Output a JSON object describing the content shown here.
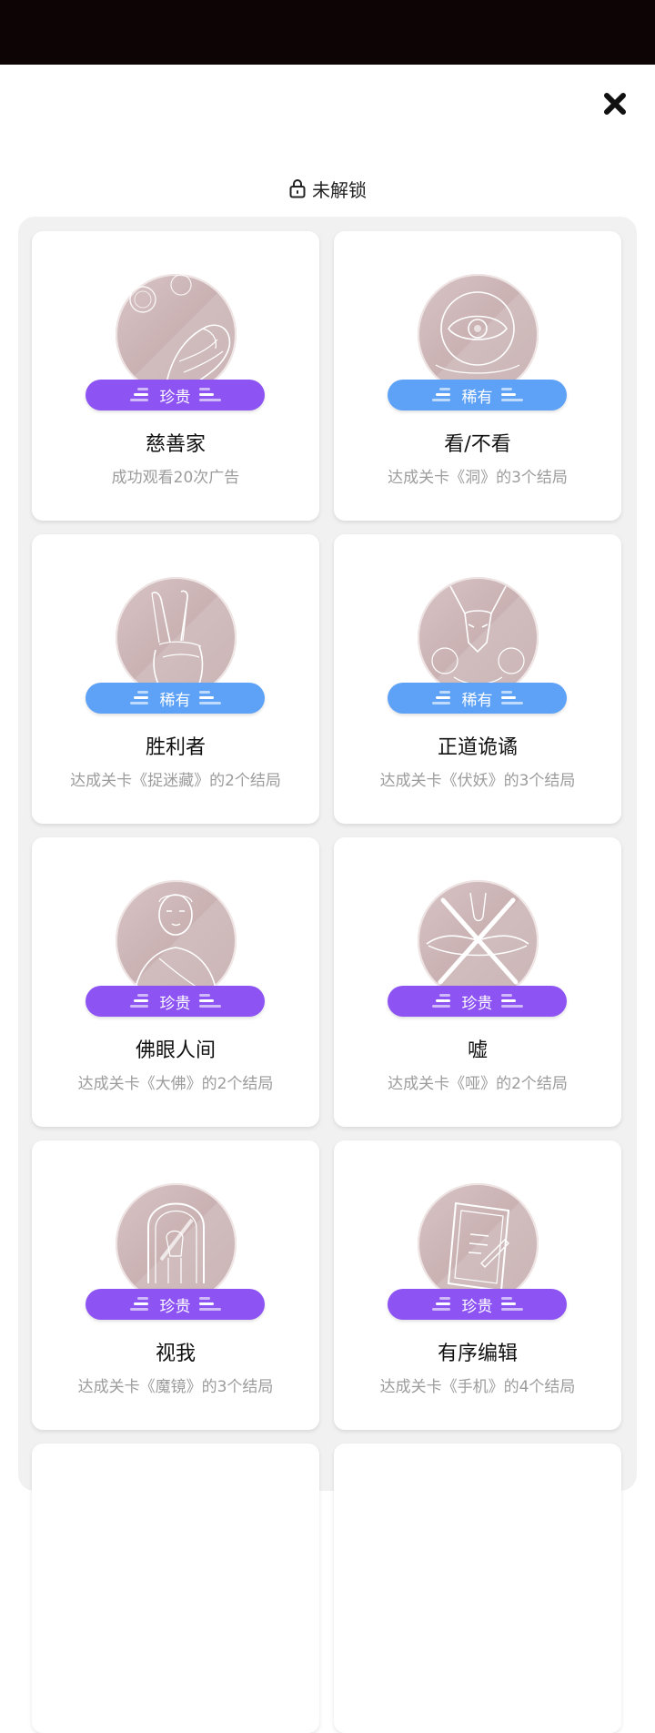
{
  "header": {
    "title": "未解锁"
  },
  "achievements": [
    {
      "name": "慈善家",
      "desc": "成功观看20次广告",
      "rarity": "珍贵",
      "tier": "precious",
      "image_icon": "coin-hand-sketch-icon"
    },
    {
      "name": "看/不看",
      "desc": "达成关卡《洞》的3个结局",
      "rarity": "稀有",
      "tier": "rare",
      "image_icon": "eye-sketch-icon"
    },
    {
      "name": "胜利者",
      "desc": "达成关卡《捉迷藏》的2个结局",
      "rarity": "稀有",
      "tier": "rare",
      "image_icon": "victory-hand-sketch-icon"
    },
    {
      "name": "正道诡谲",
      "desc": "达成关卡《伏妖》的3个结局",
      "rarity": "稀有",
      "tier": "rare",
      "image_icon": "fox-demon-sketch-icon"
    },
    {
      "name": "佛眼人间",
      "desc": "达成关卡《大佛》的2个结局",
      "rarity": "珍贵",
      "tier": "precious",
      "image_icon": "buddha-sketch-icon"
    },
    {
      "name": "嘘",
      "desc": "达成关卡《哑》的2个结局",
      "rarity": "珍贵",
      "tier": "precious",
      "image_icon": "crossed-mouth-sketch-icon"
    },
    {
      "name": "视我",
      "desc": "达成关卡《魔镜》的3个结局",
      "rarity": "珍贵",
      "tier": "precious",
      "image_icon": "mirror-sketch-icon"
    },
    {
      "name": "有序编辑",
      "desc": "达成关卡《手机》的4个结局",
      "rarity": "珍贵",
      "tier": "precious",
      "image_icon": "phone-sketch-icon"
    },
    {
      "name": "",
      "desc": "",
      "rarity": "",
      "tier": "",
      "image_icon": ""
    },
    {
      "name": "",
      "desc": "",
      "rarity": "",
      "tier": "",
      "image_icon": ""
    }
  ],
  "colors": {
    "rare": "#5ea2f7",
    "precious": "#8d53f3",
    "statusbar": "#0c0405",
    "panel": "#f1f1f1"
  }
}
